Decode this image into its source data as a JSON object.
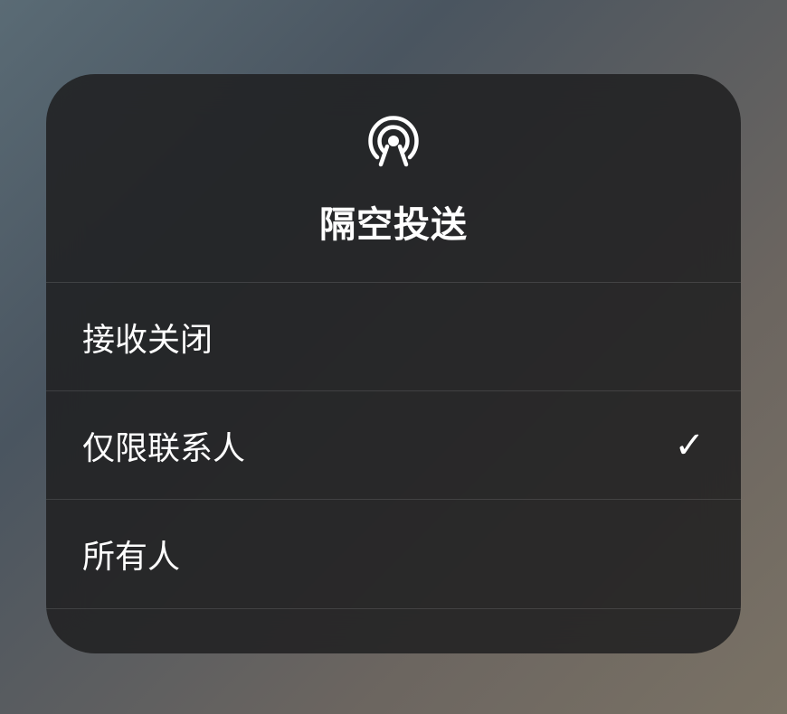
{
  "header": {
    "title": "隔空投送",
    "icon_name": "airdrop-icon"
  },
  "options": [
    {
      "label": "接收关闭",
      "selected": false
    },
    {
      "label": "仅限联系人",
      "selected": true
    },
    {
      "label": "所有人",
      "selected": false
    }
  ]
}
